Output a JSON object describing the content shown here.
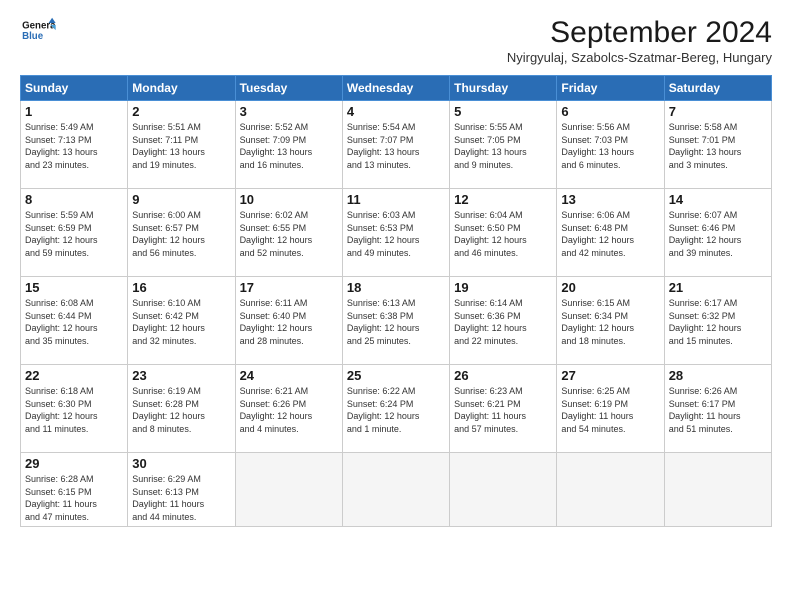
{
  "header": {
    "logo_line1": "General",
    "logo_line2": "Blue",
    "month_title": "September 2024",
    "location": "Nyirgyulaj, Szabolcs-Szatmar-Bereg, Hungary"
  },
  "weekdays": [
    "Sunday",
    "Monday",
    "Tuesday",
    "Wednesday",
    "Thursday",
    "Friday",
    "Saturday"
  ],
  "weeks": [
    [
      {
        "day": "1",
        "info": "Sunrise: 5:49 AM\nSunset: 7:13 PM\nDaylight: 13 hours\nand 23 minutes."
      },
      {
        "day": "2",
        "info": "Sunrise: 5:51 AM\nSunset: 7:11 PM\nDaylight: 13 hours\nand 19 minutes."
      },
      {
        "day": "3",
        "info": "Sunrise: 5:52 AM\nSunset: 7:09 PM\nDaylight: 13 hours\nand 16 minutes."
      },
      {
        "day": "4",
        "info": "Sunrise: 5:54 AM\nSunset: 7:07 PM\nDaylight: 13 hours\nand 13 minutes."
      },
      {
        "day": "5",
        "info": "Sunrise: 5:55 AM\nSunset: 7:05 PM\nDaylight: 13 hours\nand 9 minutes."
      },
      {
        "day": "6",
        "info": "Sunrise: 5:56 AM\nSunset: 7:03 PM\nDaylight: 13 hours\nand 6 minutes."
      },
      {
        "day": "7",
        "info": "Sunrise: 5:58 AM\nSunset: 7:01 PM\nDaylight: 13 hours\nand 3 minutes."
      }
    ],
    [
      {
        "day": "8",
        "info": "Sunrise: 5:59 AM\nSunset: 6:59 PM\nDaylight: 12 hours\nand 59 minutes."
      },
      {
        "day": "9",
        "info": "Sunrise: 6:00 AM\nSunset: 6:57 PM\nDaylight: 12 hours\nand 56 minutes."
      },
      {
        "day": "10",
        "info": "Sunrise: 6:02 AM\nSunset: 6:55 PM\nDaylight: 12 hours\nand 52 minutes."
      },
      {
        "day": "11",
        "info": "Sunrise: 6:03 AM\nSunset: 6:53 PM\nDaylight: 12 hours\nand 49 minutes."
      },
      {
        "day": "12",
        "info": "Sunrise: 6:04 AM\nSunset: 6:50 PM\nDaylight: 12 hours\nand 46 minutes."
      },
      {
        "day": "13",
        "info": "Sunrise: 6:06 AM\nSunset: 6:48 PM\nDaylight: 12 hours\nand 42 minutes."
      },
      {
        "day": "14",
        "info": "Sunrise: 6:07 AM\nSunset: 6:46 PM\nDaylight: 12 hours\nand 39 minutes."
      }
    ],
    [
      {
        "day": "15",
        "info": "Sunrise: 6:08 AM\nSunset: 6:44 PM\nDaylight: 12 hours\nand 35 minutes."
      },
      {
        "day": "16",
        "info": "Sunrise: 6:10 AM\nSunset: 6:42 PM\nDaylight: 12 hours\nand 32 minutes."
      },
      {
        "day": "17",
        "info": "Sunrise: 6:11 AM\nSunset: 6:40 PM\nDaylight: 12 hours\nand 28 minutes."
      },
      {
        "day": "18",
        "info": "Sunrise: 6:13 AM\nSunset: 6:38 PM\nDaylight: 12 hours\nand 25 minutes."
      },
      {
        "day": "19",
        "info": "Sunrise: 6:14 AM\nSunset: 6:36 PM\nDaylight: 12 hours\nand 22 minutes."
      },
      {
        "day": "20",
        "info": "Sunrise: 6:15 AM\nSunset: 6:34 PM\nDaylight: 12 hours\nand 18 minutes."
      },
      {
        "day": "21",
        "info": "Sunrise: 6:17 AM\nSunset: 6:32 PM\nDaylight: 12 hours\nand 15 minutes."
      }
    ],
    [
      {
        "day": "22",
        "info": "Sunrise: 6:18 AM\nSunset: 6:30 PM\nDaylight: 12 hours\nand 11 minutes."
      },
      {
        "day": "23",
        "info": "Sunrise: 6:19 AM\nSunset: 6:28 PM\nDaylight: 12 hours\nand 8 minutes."
      },
      {
        "day": "24",
        "info": "Sunrise: 6:21 AM\nSunset: 6:26 PM\nDaylight: 12 hours\nand 4 minutes."
      },
      {
        "day": "25",
        "info": "Sunrise: 6:22 AM\nSunset: 6:24 PM\nDaylight: 12 hours\nand 1 minute."
      },
      {
        "day": "26",
        "info": "Sunrise: 6:23 AM\nSunset: 6:21 PM\nDaylight: 11 hours\nand 57 minutes."
      },
      {
        "day": "27",
        "info": "Sunrise: 6:25 AM\nSunset: 6:19 PM\nDaylight: 11 hours\nand 54 minutes."
      },
      {
        "day": "28",
        "info": "Sunrise: 6:26 AM\nSunset: 6:17 PM\nDaylight: 11 hours\nand 51 minutes."
      }
    ],
    [
      {
        "day": "29",
        "info": "Sunrise: 6:28 AM\nSunset: 6:15 PM\nDaylight: 11 hours\nand 47 minutes."
      },
      {
        "day": "30",
        "info": "Sunrise: 6:29 AM\nSunset: 6:13 PM\nDaylight: 11 hours\nand 44 minutes."
      },
      null,
      null,
      null,
      null,
      null
    ]
  ]
}
